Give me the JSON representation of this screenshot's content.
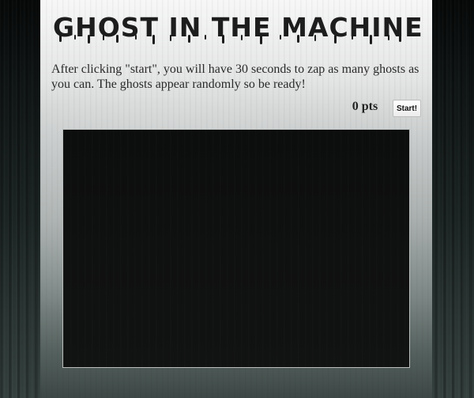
{
  "header": {
    "title": "GHOST IN THE MACHINE"
  },
  "intro": {
    "text": "After clicking \"start\", you will have 30 seconds to zap as many ghosts as you can. The ghosts appear randomly so be ready!"
  },
  "scoreboard": {
    "score": "0 pts"
  },
  "controls": {
    "start_label": "Start!"
  },
  "colors": {
    "title": "#1d1d1d",
    "game_area": "#0f1010",
    "page_background": "#1b2423"
  }
}
